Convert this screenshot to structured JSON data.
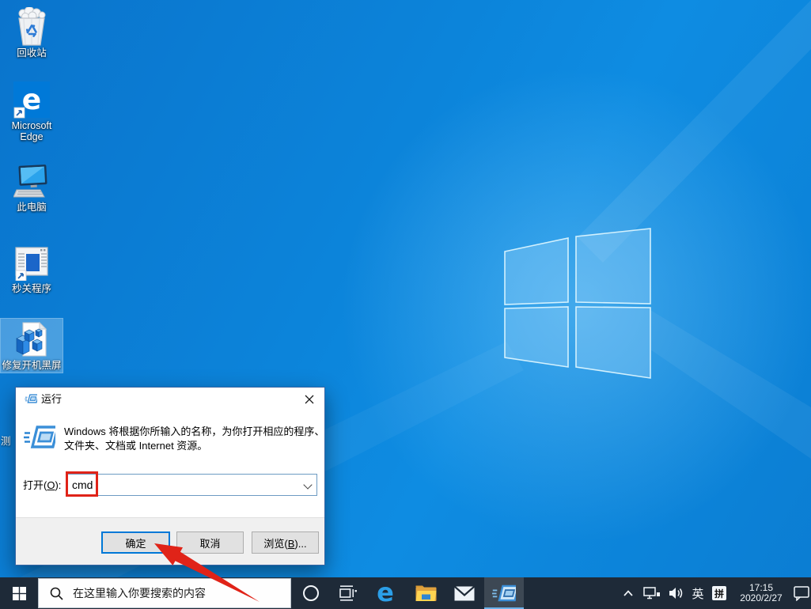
{
  "colors": {
    "accent": "#0078d7",
    "annotation_red": "#e02318",
    "taskbar_bg": "#1e2a38",
    "wallpaper_base": "#0c84da",
    "active_app_underline": "#6ab1ea"
  },
  "desktop": {
    "icons": [
      {
        "name": "recycle-bin",
        "label": "回收站"
      },
      {
        "name": "microsoft-edge",
        "label": "Microsoft Edge"
      },
      {
        "name": "this-pc",
        "label": "此电脑"
      },
      {
        "name": "quick-close-program",
        "label": "秒关程序"
      },
      {
        "name": "fix-boot-black-screen",
        "label": "修复开机黑屏",
        "selected": true
      },
      {
        "name": "partially-hidden-icon",
        "label": "测"
      }
    ]
  },
  "run_dialog": {
    "title": "运行",
    "description_line1": "Windows 将根据你所输入的名称，为你打开相应的程序、",
    "description_line2": "文件夹、文档或 Internet 资源。",
    "open_label": {
      "pre": "打开(",
      "key": "O",
      "post": "):"
    },
    "input_value": "cmd",
    "buttons": {
      "ok": "确定",
      "cancel": "取消",
      "browse": {
        "pre": "浏览(",
        "key": "B",
        "post": ")..."
      }
    }
  },
  "taskbar": {
    "search_placeholder": "在这里输入你要搜索的内容",
    "app_icons": [
      "start-windows-logo",
      "search-magnifier",
      "cortana-circle",
      "task-view",
      "edge-e",
      "file-explorer-folder",
      "mail-envelope",
      "run-window-active"
    ],
    "tray": {
      "hidden_icons_chevron": "^",
      "ime_language": "英",
      "ime_mode": "拼",
      "time": "17:15",
      "date": "2020/2/27"
    }
  },
  "annotations": {
    "red_box_target": "cmd text in Open field",
    "red_arrow_target": "OK button"
  }
}
